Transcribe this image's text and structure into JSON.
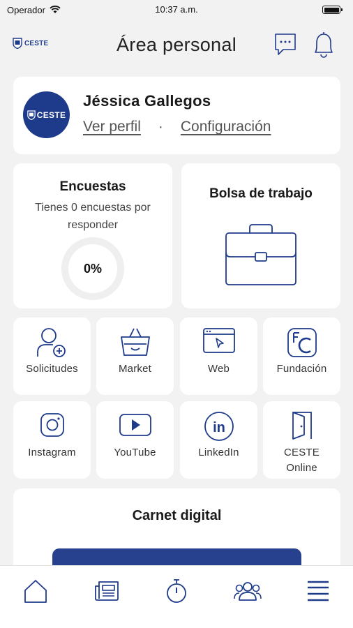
{
  "status_bar": {
    "carrier": "Operador",
    "time": "10:37 a.m."
  },
  "header": {
    "logo_text": "CESTE",
    "title": "Área personal"
  },
  "profile": {
    "avatar_text": "CESTE",
    "name": "Jéssica Gallegos",
    "view_profile": "Ver perfil",
    "separator": "·",
    "settings": "Configuración"
  },
  "surveys": {
    "title": "Encuestas",
    "subtitle": "Tienes 0 encuestas por responder",
    "percent": "0%",
    "progress_fraction": 0
  },
  "jobs": {
    "title": "Bolsa de trabajo"
  },
  "tiles": [
    {
      "label": "Solicitudes",
      "icon": "user-add-icon"
    },
    {
      "label": "Market",
      "icon": "basket-icon"
    },
    {
      "label": "Web",
      "icon": "browser-cursor-icon"
    },
    {
      "label": "Fundación",
      "icon": "fc-logo-icon"
    },
    {
      "label": "Instagram",
      "icon": "instagram-icon"
    },
    {
      "label": "YouTube",
      "icon": "youtube-icon"
    },
    {
      "label": "LinkedIn",
      "icon": "linkedin-icon"
    },
    {
      "label": "CESTE Online",
      "icon": "door-icon"
    }
  ],
  "carnet": {
    "title": "Carnet digital"
  },
  "tabbar": {
    "items": [
      {
        "icon": "home-icon"
      },
      {
        "icon": "news-icon"
      },
      {
        "icon": "stopwatch-icon"
      },
      {
        "icon": "community-icon"
      },
      {
        "icon": "menu-icon"
      }
    ]
  },
  "colors": {
    "brand": "#1e3a8a",
    "card": "#ffffff",
    "background": "#f2f2f2"
  }
}
